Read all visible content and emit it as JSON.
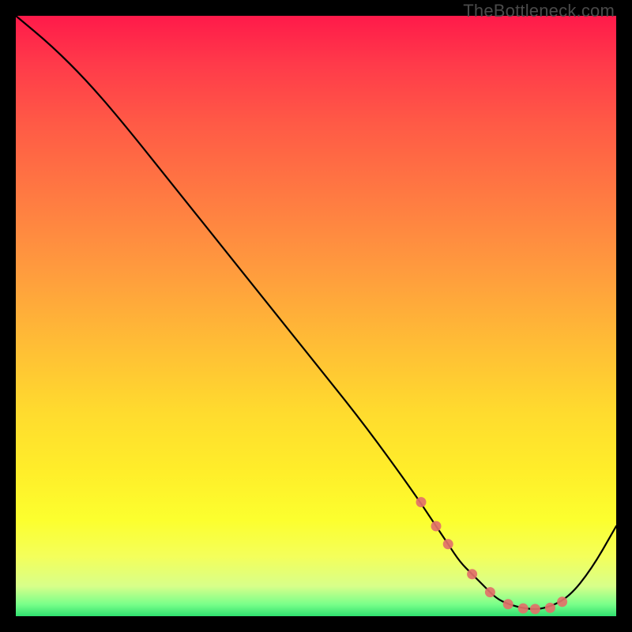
{
  "watermark": "TheBottleneck.com",
  "colors": {
    "background": "#000000",
    "line": "#000000",
    "marker": "#e27169",
    "gradient_top": "#ff1a4a",
    "gradient_bottom": "#30e070"
  },
  "chart_data": {
    "type": "line",
    "title": "",
    "xlabel": "",
    "ylabel": "",
    "xlim": [
      0,
      100
    ],
    "ylim": [
      0,
      100
    ],
    "curve": {
      "x": [
        0,
        6,
        12,
        18,
        26,
        34,
        42,
        50,
        58,
        66,
        70,
        72,
        74,
        76,
        78,
        80,
        82,
        85,
        88,
        92,
        96,
        100
      ],
      "y": [
        100,
        95,
        89,
        82,
        72,
        62,
        52,
        42,
        32,
        21,
        15,
        12,
        9,
        7,
        5,
        3,
        2,
        1.2,
        1.2,
        3,
        8,
        15
      ]
    },
    "markers": {
      "x": [
        67.5,
        70.0,
        72.0,
        76.0,
        79.0,
        82.0,
        84.5,
        86.5,
        89.0,
        91.0
      ],
      "y": [
        19.0,
        15.0,
        12.0,
        7.0,
        4.0,
        2.0,
        1.3,
        1.2,
        1.4,
        2.4
      ]
    }
  }
}
